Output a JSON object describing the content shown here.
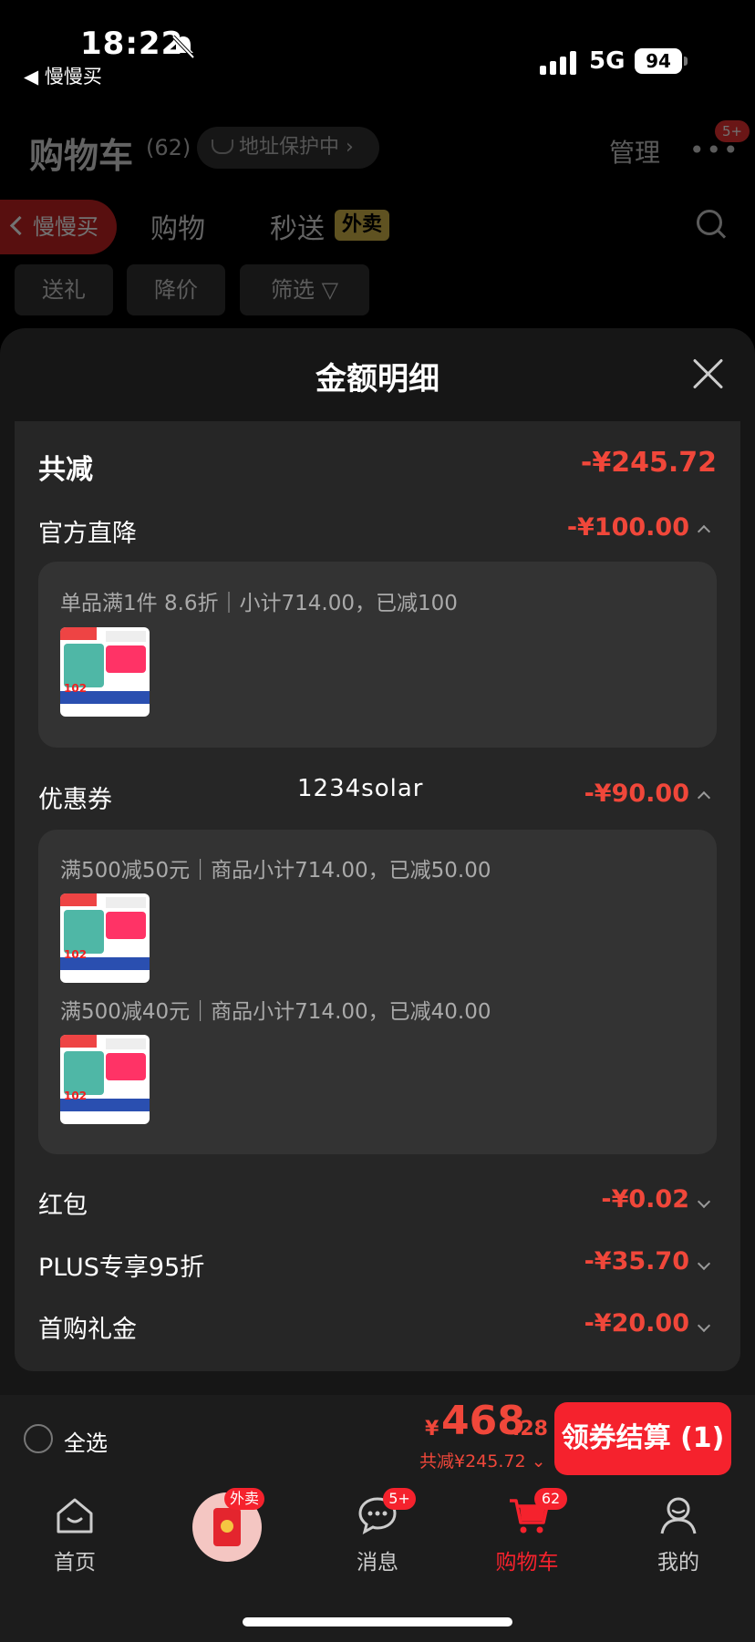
{
  "status": {
    "time": "18:22",
    "back_app": "◀ 慢慢买",
    "network": "5G",
    "battery": "94"
  },
  "cart": {
    "title": "购物车",
    "count": "(62)",
    "address": "地址保护中 ›",
    "manage": "管理",
    "more": "•••",
    "more_badge": "5+",
    "back_pill": "慢慢买",
    "tabs": [
      "购物",
      "秒送"
    ],
    "tag": "外卖",
    "chips": [
      "送礼",
      "降价",
      "筛选 ▽"
    ]
  },
  "sheet": {
    "title": "金额明细",
    "total_label": "共减",
    "total_value": "-¥245.72",
    "official": {
      "label": "官方直降",
      "value": "-¥100.00",
      "detail": "单品满1件 8.6折｜小计714.00，已减100"
    },
    "coupon": {
      "label": "优惠券",
      "value": "-¥90.00",
      "detail1": "满500减50元｜商品小计714.00，已减50.00",
      "detail2": "满500减40元｜商品小计714.00，已减40.00"
    },
    "watermark": "1234solar",
    "rows": [
      {
        "label": "红包",
        "value": "-¥0.02"
      },
      {
        "label": "PLUS专享95折",
        "value": "-¥35.70"
      },
      {
        "label": "首购礼金",
        "value": "-¥20.00"
      }
    ]
  },
  "checkout": {
    "select_all": "全选",
    "yen": "¥",
    "price_int": "468",
    "price_dec": ".28",
    "sub": "共减¥245.72 ⌄",
    "button": "领券结算 (1)"
  },
  "tabbar": {
    "items": [
      {
        "label": "首页"
      },
      {
        "label": "外卖"
      },
      {
        "label": "消息",
        "badge": "5+"
      },
      {
        "label": "购物车",
        "badge": "62"
      },
      {
        "label": "我的"
      }
    ]
  },
  "colors": {
    "accent": "#f0473a",
    "primary_button": "#f5222d",
    "sheet_bg": "#161616",
    "panel_bg": "#262626"
  }
}
